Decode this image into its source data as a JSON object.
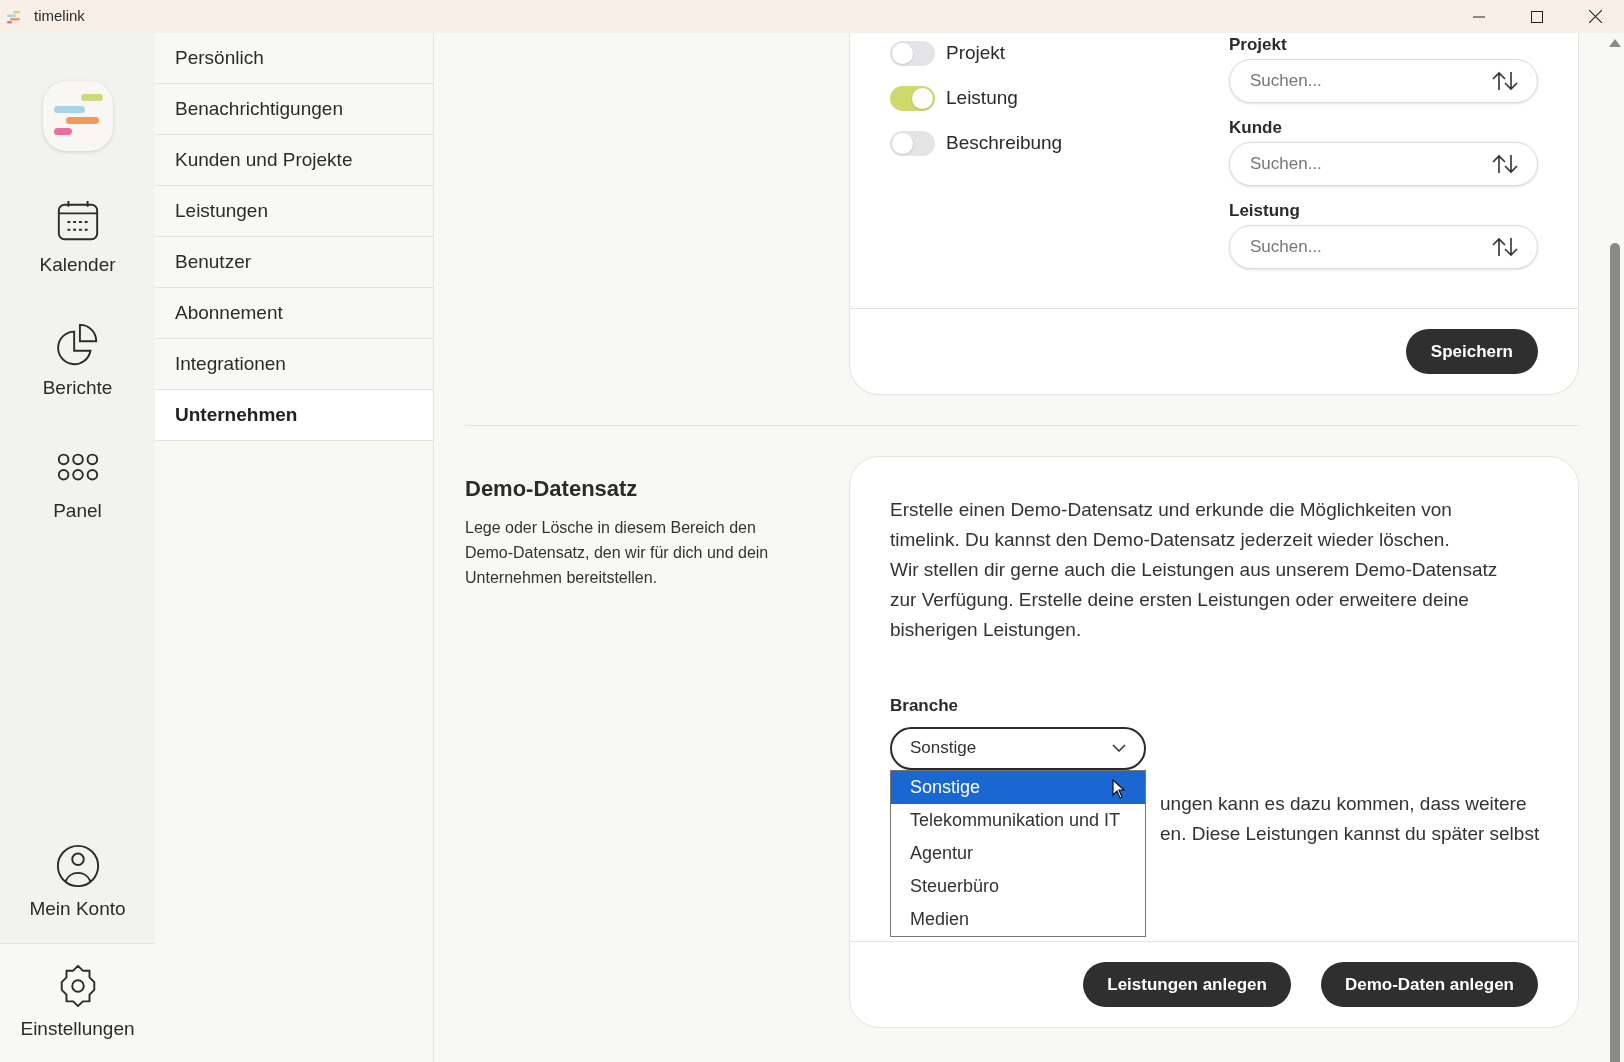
{
  "window": {
    "title": "timelink"
  },
  "rail": {
    "items": [
      {
        "kind": "calendar",
        "label": "Kalender",
        "selected": false
      },
      {
        "kind": "reports",
        "label": "Berichte",
        "selected": false
      },
      {
        "kind": "panel",
        "label": "Panel",
        "selected": false
      }
    ],
    "footer": [
      {
        "kind": "account",
        "label": "Mein Konto",
        "selected": false
      },
      {
        "kind": "settings",
        "label": "Einstellungen",
        "selected": true
      }
    ]
  },
  "settings_nav": [
    {
      "label": "Persönlich",
      "selected": false
    },
    {
      "label": "Benachrichtigungen",
      "selected": false
    },
    {
      "label": "Kunden und Projekte",
      "selected": false
    },
    {
      "label": "Leistungen",
      "selected": false
    },
    {
      "label": "Benutzer",
      "selected": false
    },
    {
      "label": "Abonnement",
      "selected": false
    },
    {
      "label": "Integrationen",
      "selected": false
    },
    {
      "label": "Unternehmen",
      "selected": true
    }
  ],
  "field_card": {
    "toggles": [
      {
        "label": "Projekt",
        "on": false
      },
      {
        "label": "Leistung",
        "on": true
      },
      {
        "label": "Beschreibung",
        "on": false
      }
    ],
    "sort_fields": [
      {
        "label": "Projekt",
        "placeholder": "Suchen..."
      },
      {
        "label": "Kunde",
        "placeholder": "Suchen..."
      },
      {
        "label": "Leistung",
        "placeholder": "Suchen..."
      }
    ],
    "save_button": "Speichern"
  },
  "demo": {
    "title": "Demo-Datensatz",
    "description": "Lege oder Lösche in diesem Bereich den Demo-Datensatz, den wir für dich und dein Unternehmen bereitstellen.",
    "intro": [
      "Erstelle einen Demo-Datensatz und erkunde die Möglichkeiten von timelink. Du kannst den Demo-Datensatz jederzeit wieder löschen.",
      "Wir stellen dir gerne auch die Leistungen aus unserem Demo-Datensatz zur Verfügung. Erstelle deine ersten Leistungen oder erweitere deine bisherigen Leistungen."
    ],
    "select_label": "Branche",
    "select_value": "Sonstige",
    "options": [
      {
        "label": "Sonstige",
        "selected": true
      },
      {
        "label": "Telekommunikation und IT",
        "selected": false
      },
      {
        "label": "Agentur",
        "selected": false
      },
      {
        "label": "Steuerbüro",
        "selected": false
      },
      {
        "label": "Medien",
        "selected": false
      }
    ],
    "note_lines": [
      "ungen kann es dazu kommen, dass weitere",
      "en. Diese Leistungen kannst du später selbst"
    ],
    "buttons": [
      "Leistungen anlegen",
      "Demo-Daten anlegen"
    ]
  }
}
